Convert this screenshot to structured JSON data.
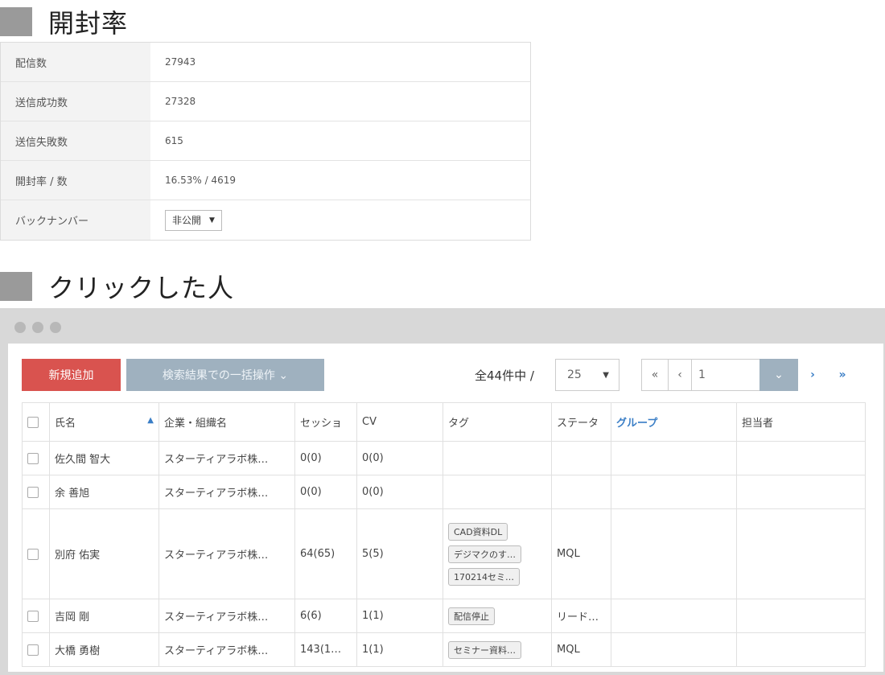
{
  "sections": {
    "open_rate_title": "開封率",
    "clicked_title": "クリックした人"
  },
  "stats": [
    {
      "label": "配信数",
      "value": "27943"
    },
    {
      "label": "送信成功数",
      "value": "27328"
    },
    {
      "label": "送信失敗数",
      "value": "615"
    },
    {
      "label": "開封率 / 数",
      "value": "16.53% / 4619"
    },
    {
      "label": "バックナンバー",
      "value": "非公開"
    }
  ],
  "toolbar": {
    "new_label": "新規追加",
    "bulk_label": "検索結果での一括操作 ⌄",
    "total_label": "全44件中 /",
    "per_page": "25",
    "pager_first": "«",
    "pager_prev": "‹",
    "page_value": "1",
    "pager_go": "⌄",
    "pager_next": "›",
    "pager_last": "»"
  },
  "table": {
    "headers": [
      "氏名",
      "企業・組織名",
      "セッショ",
      "CV",
      "タグ",
      "ステータ",
      "グループ",
      "担当者"
    ],
    "rows": [
      {
        "name": "佐久間 智大",
        "company": "スターティアラボ株…",
        "session": "0(0)",
        "cv": "0(0)",
        "tags": [],
        "status": "",
        "group": "",
        "owner": ""
      },
      {
        "name": "余 善旭",
        "company": "スターティアラボ株…",
        "session": "0(0)",
        "cv": "0(0)",
        "tags": [],
        "status": "",
        "group": "",
        "owner": ""
      },
      {
        "name": "別府 佑実",
        "company": "スターティアラボ株…",
        "session": "64(65)",
        "cv": "5(5)",
        "tags": [
          "CAD資料DL",
          "デジマクのす…",
          "170214セミ…"
        ],
        "status": "MQL",
        "group": "",
        "owner": ""
      },
      {
        "name": "吉岡 剛",
        "company": "スターティアラボ株…",
        "session": "6(6)",
        "cv": "1(1)",
        "tags": [
          "配信停止"
        ],
        "status": "リード…",
        "group": "",
        "owner": ""
      },
      {
        "name": "大橋 勇樹",
        "company": "スターティアラボ株…",
        "session": "143(1…",
        "cv": "1(1)",
        "tags": [
          "セミナー資料…"
        ],
        "status": "MQL",
        "group": "",
        "owner": ""
      }
    ]
  }
}
